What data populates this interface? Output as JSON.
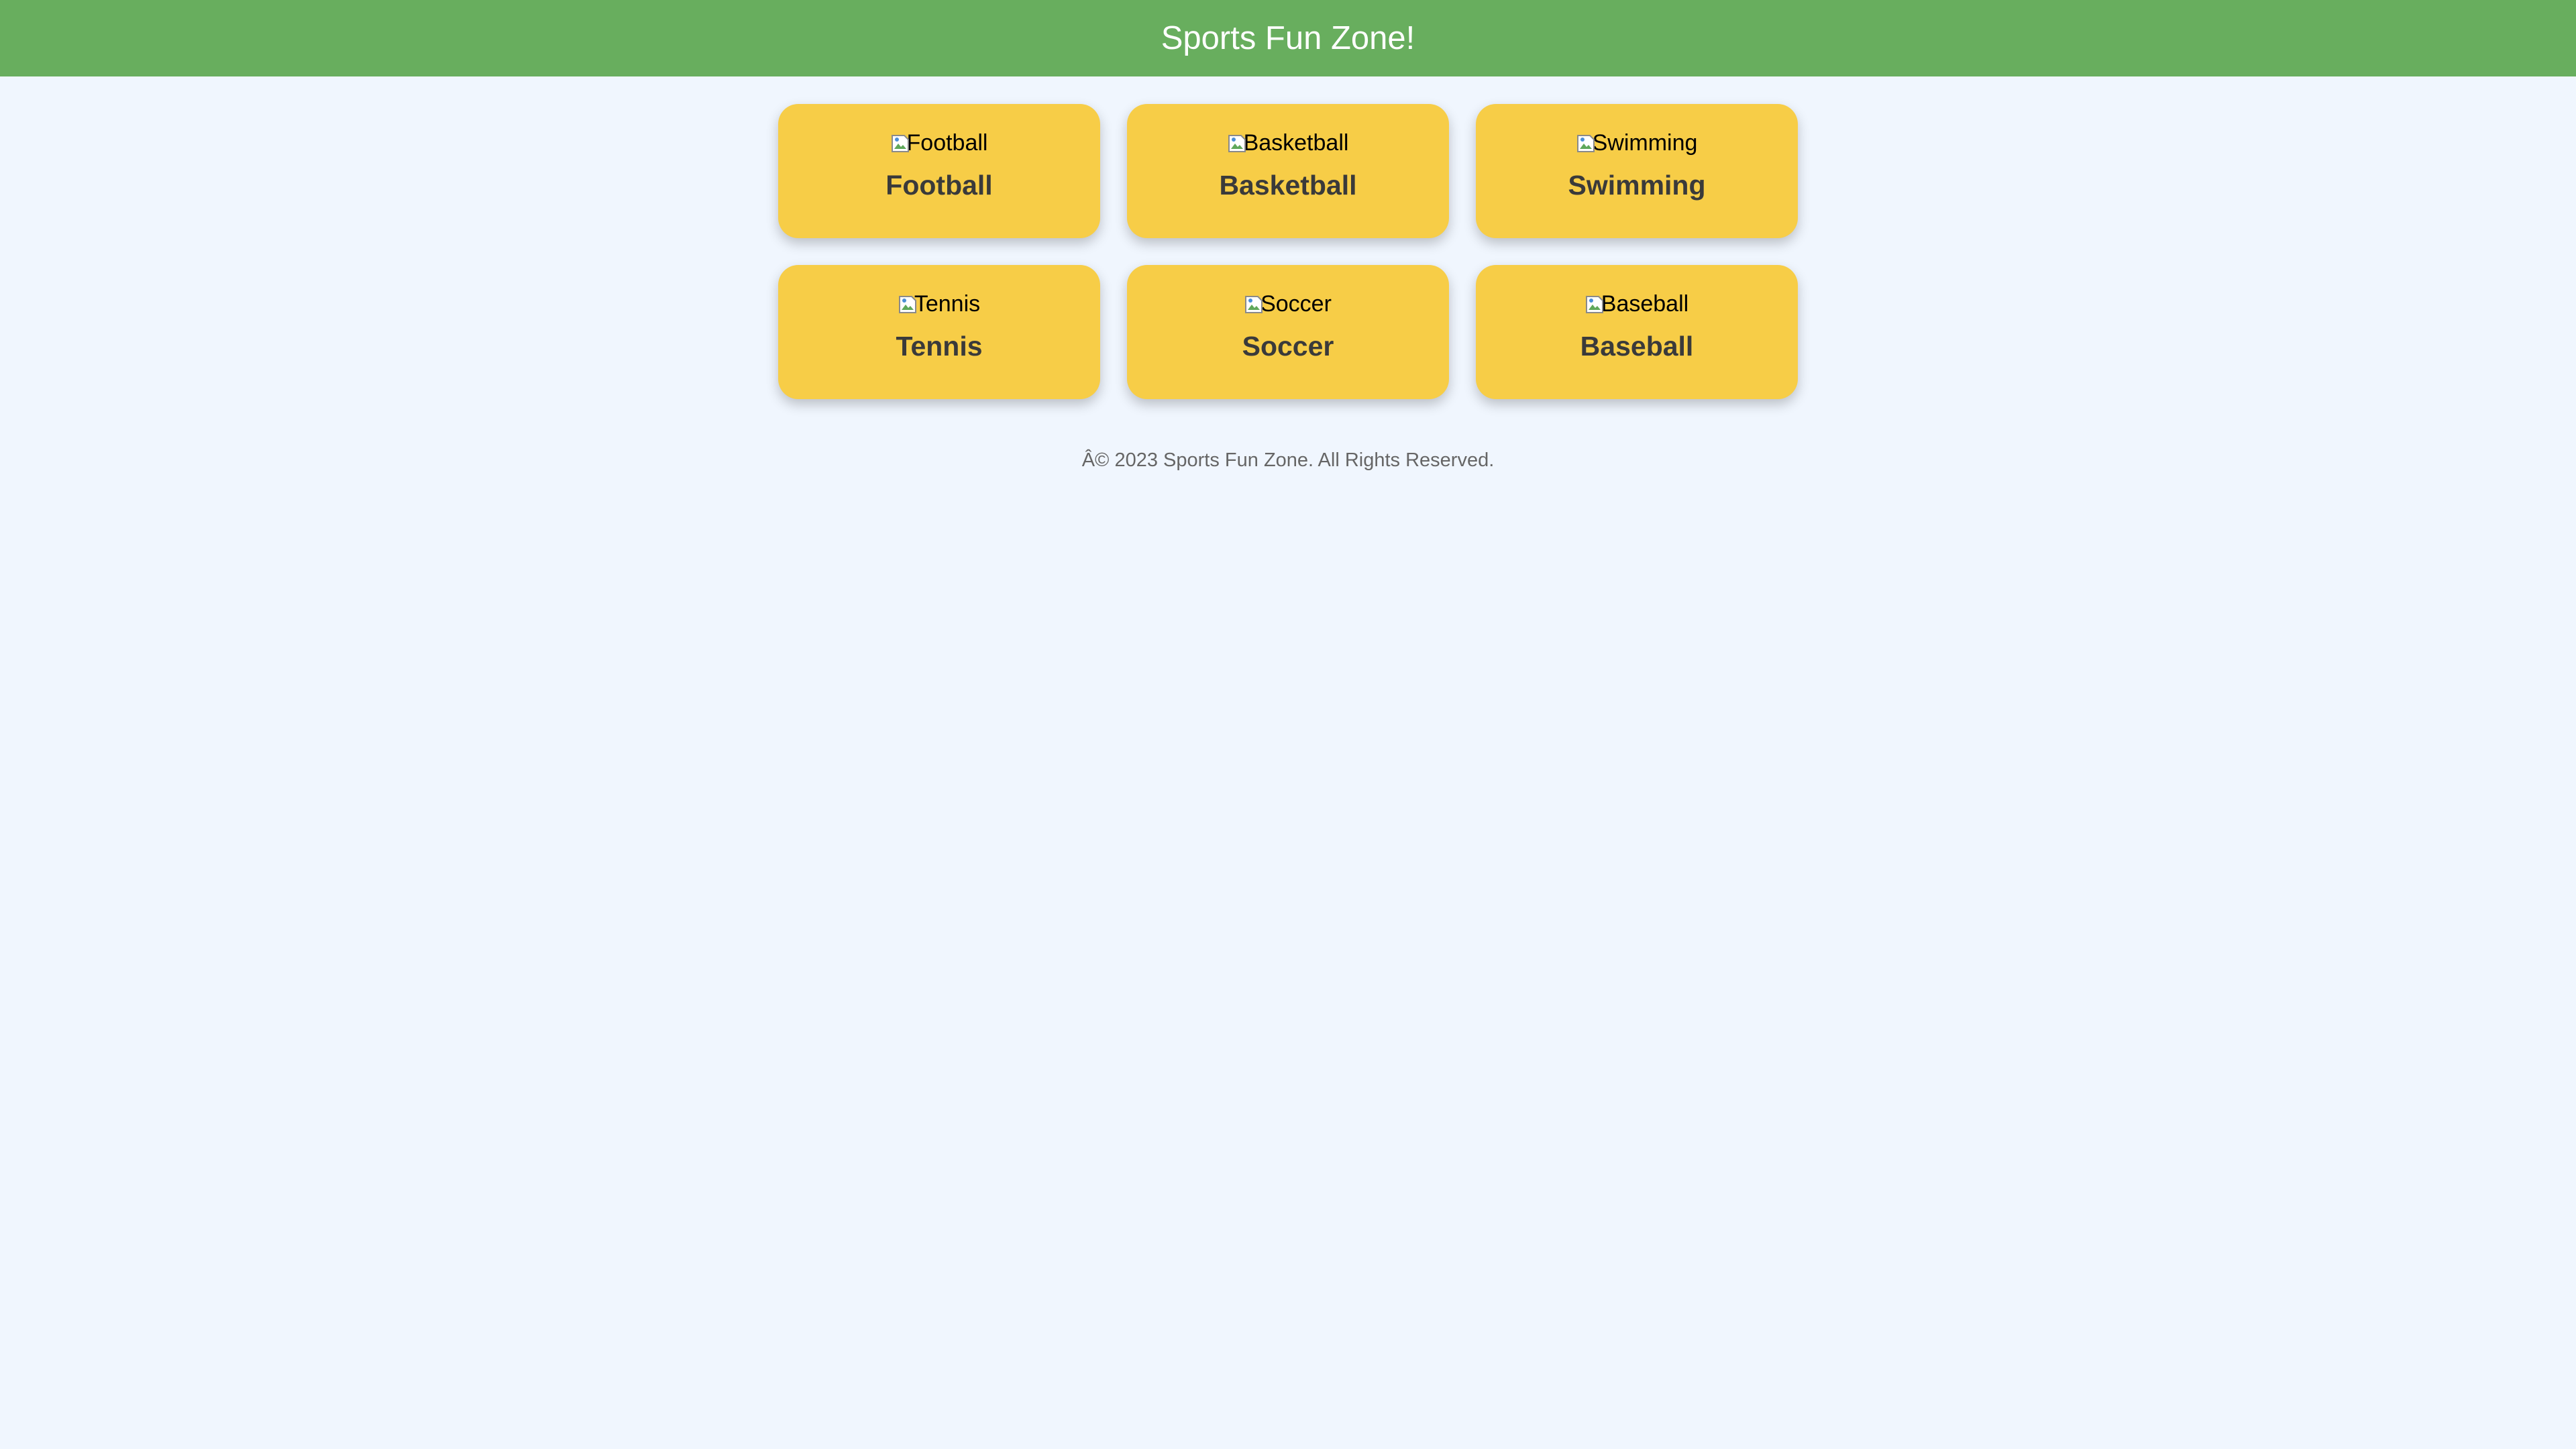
{
  "header": {
    "title": "Sports Fun Zone!"
  },
  "sports": [
    {
      "alt": "Football",
      "label": "Football",
      "icon": "broken-image-icon"
    },
    {
      "alt": "Basketball",
      "label": "Basketball",
      "icon": "broken-image-icon"
    },
    {
      "alt": "Swimming",
      "label": "Swimming",
      "icon": "broken-image-icon"
    },
    {
      "alt": "Tennis",
      "label": "Tennis",
      "icon": "broken-image-icon"
    },
    {
      "alt": "Soccer",
      "label": "Soccer",
      "icon": "broken-image-icon"
    },
    {
      "alt": "Baseball",
      "label": "Baseball",
      "icon": "broken-image-icon"
    }
  ],
  "footer": {
    "text": "Â© 2023 Sports Fun Zone. All Rights Reserved."
  },
  "colors": {
    "header_bg": "#68ae5e",
    "page_bg": "#f0f6fe",
    "card_bg": "#f7cd47",
    "label_text": "#3a3a3a",
    "footer_text": "#666666"
  }
}
